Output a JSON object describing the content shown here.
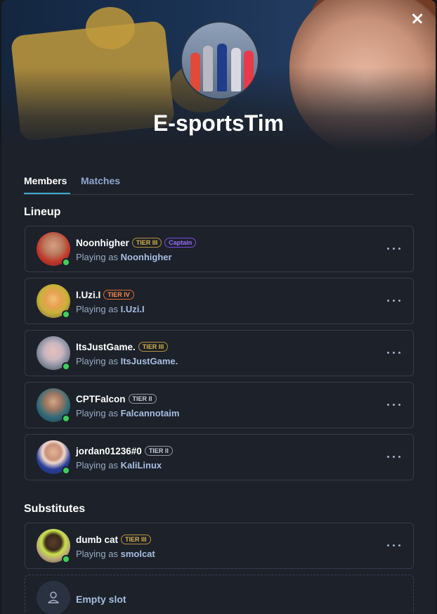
{
  "team": {
    "name": "E-sportsTim"
  },
  "tabs": [
    {
      "label": "Members"
    },
    {
      "label": "Matches"
    }
  ],
  "sections": {
    "lineup": "Lineup",
    "substitutes": "Substitutes"
  },
  "playing_as_prefix": "Playing as",
  "lineup": [
    {
      "name": "Noonhigher",
      "tier": "TIER III",
      "role": "Captain",
      "playing_as": "Noonhigher"
    },
    {
      "name": "I.Uzi.I",
      "tier": "TIER IV",
      "playing_as": "I.Uzi.I"
    },
    {
      "name": "ItsJustGame.",
      "tier": "TIER III",
      "playing_as": "ItsJustGame."
    },
    {
      "name": "CPTFalcon",
      "tier": "TIER II",
      "playing_as": "Falcannotaim"
    },
    {
      "name": "jordan01236#0",
      "tier": "TIER II",
      "playing_as": "KaliLinux"
    }
  ],
  "substitutes": [
    {
      "name": "dumb cat",
      "tier": "TIER III",
      "playing_as": "smolcat"
    }
  ],
  "empty_slot": {
    "label": "Empty slot"
  },
  "colors": {
    "background": "#1c212a",
    "accent": "#3aa9c9",
    "online": "#3ecf5a",
    "tier3": "#d8b24a",
    "tier4": "#ff8a4a",
    "tier2": "#c9ced8",
    "captain": "#9a6cff"
  },
  "icons": {
    "close": "close-icon",
    "more": "more-options-icon",
    "empty_user": "user-icon"
  }
}
